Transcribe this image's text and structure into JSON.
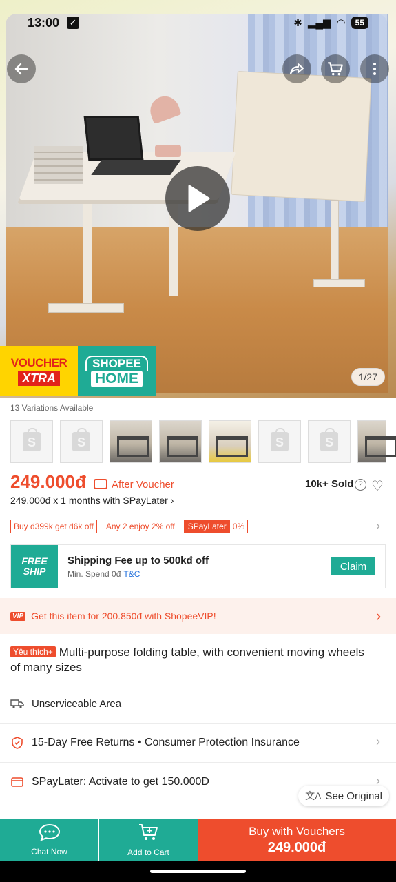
{
  "status": {
    "time": "13:00",
    "battery": "55"
  },
  "hero": {
    "counter": "1/27"
  },
  "badges": {
    "voucher_line1": "VOUCHER",
    "voucher_line2": "XTRA",
    "shopee_line1": "SHOPEE",
    "shopee_line2": "HOME"
  },
  "variations": {
    "label": "13 Variations Available"
  },
  "price": {
    "value": "249.000đ",
    "after_voucher": "After Voucher",
    "sold": "10k+ Sold",
    "paylater": "249.000đ x 1 months with SPayLater ›"
  },
  "chips": [
    "Buy đ399k get đ6k off",
    "Any 2 enjoy 2% off"
  ],
  "chip_split": {
    "a": "SPayLater",
    "b": "0%"
  },
  "shipping": {
    "badge_line1": "FREE",
    "badge_line2": "SHIP",
    "title": "Shipping Fee up to 500kđ off",
    "sub": "Min. Spend 0đ",
    "tc": "T&C",
    "claim": "Claim"
  },
  "vip": {
    "badge": "VIP",
    "text": "Get this item for 200.850đ with ShopeeVIP!"
  },
  "product": {
    "tag": "Yêu thích+",
    "title": "Multi-purpose folding table, with convenient moving wheels of many sizes"
  },
  "rows": {
    "unserviceable": "Unserviceable Area",
    "returns": "15-Day Free Returns  •  Consumer Protection Insurance",
    "spaylater": "SPayLater: Activate to get 150.000Đ"
  },
  "see_original": "See Original",
  "bottom": {
    "chat": "Chat Now",
    "add_cart": "Add to Cart",
    "buy_line1": "Buy with Vouchers",
    "buy_line2": "249.000đ"
  },
  "colors": {
    "brand_orange": "#ee4d2d",
    "teal": "#1fab95"
  }
}
